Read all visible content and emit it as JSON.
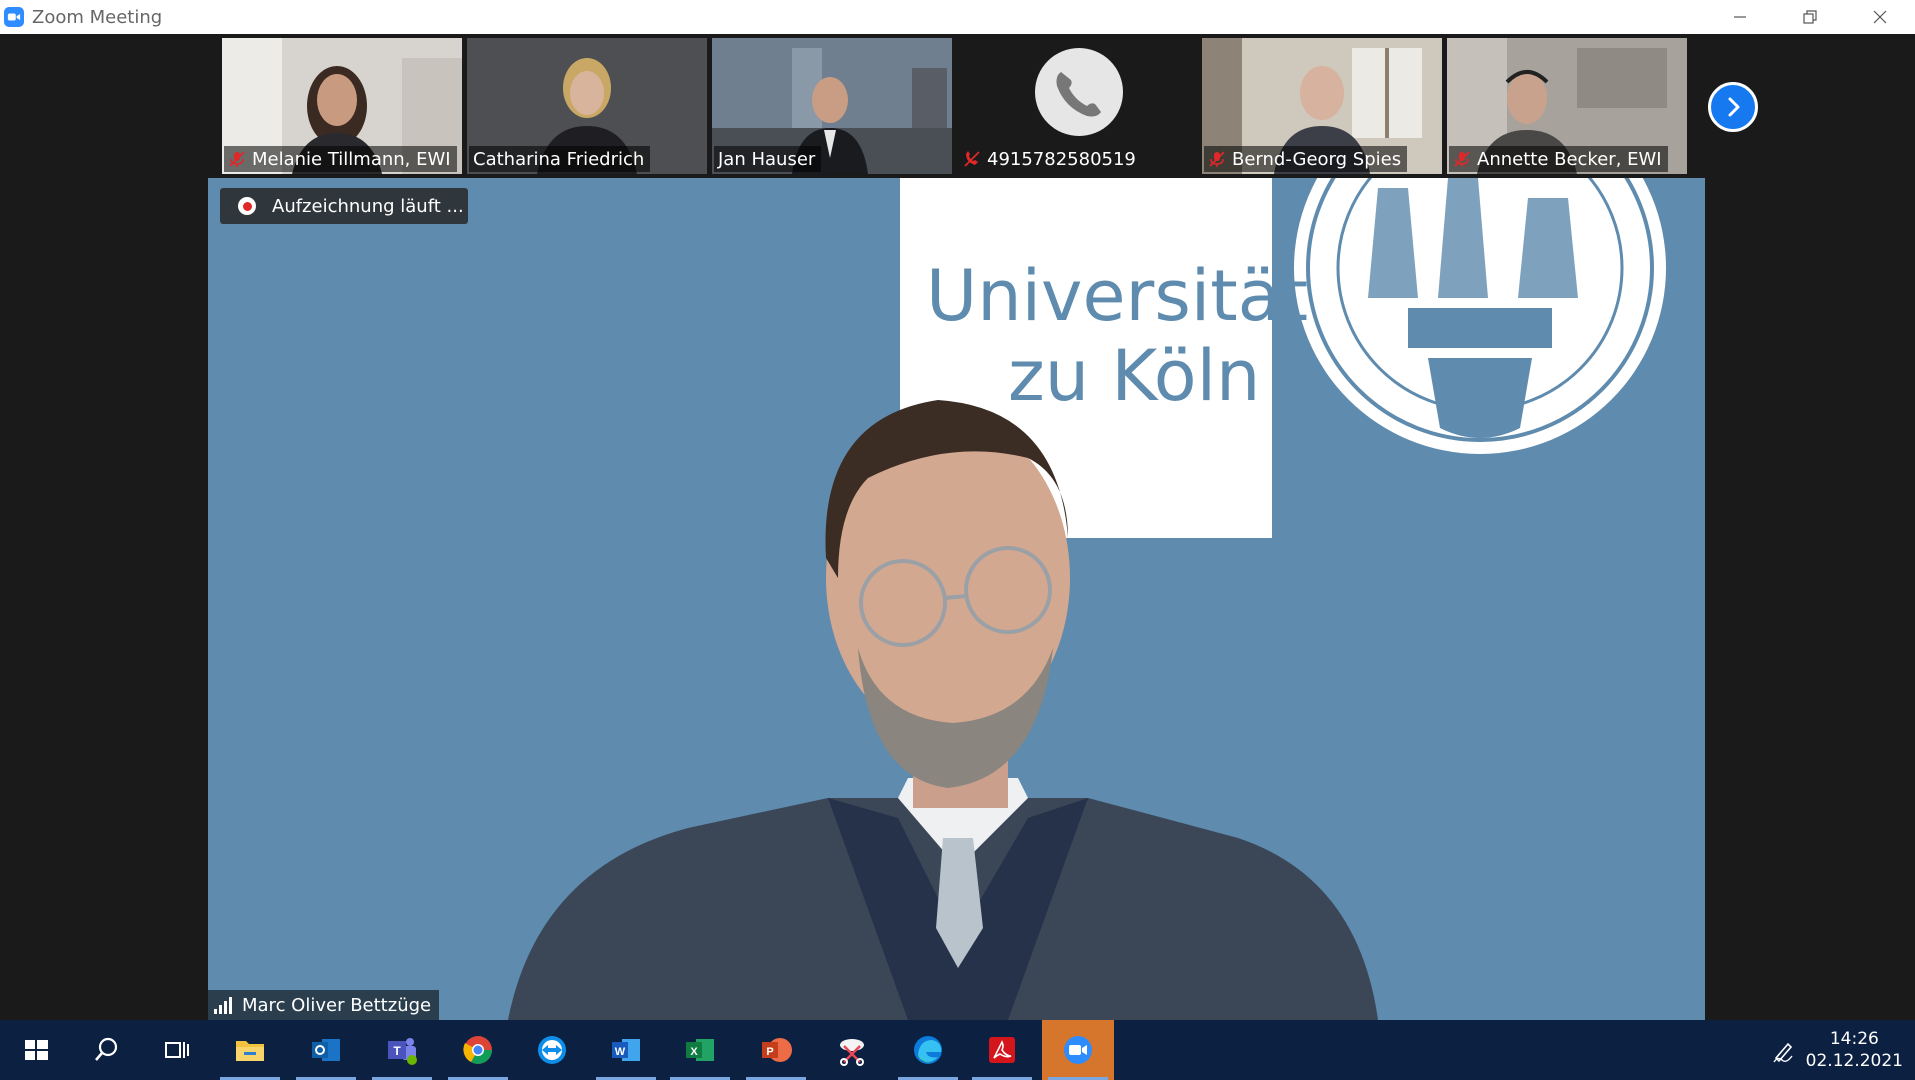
{
  "window": {
    "title": "Zoom Meeting",
    "controls": {
      "minimize": "minimize-icon",
      "restore": "restore-icon",
      "close": "close-icon"
    }
  },
  "recording": {
    "label": "Aufzeichnung läuft ..."
  },
  "participants": [
    {
      "name": "Melanie Tillmann, EWI",
      "muted": true
    },
    {
      "name": "Catharina Friedrich",
      "muted": false
    },
    {
      "name": "Jan Hauser",
      "muted": false
    },
    {
      "name": "4915782580519",
      "muted": true,
      "phone": true
    },
    {
      "name": "Bernd-Georg Spies",
      "muted": true
    },
    {
      "name": "Annette Becker, EWI",
      "muted": true
    }
  ],
  "active_speaker": {
    "name": "Marc Oliver Bettzüge"
  },
  "background": {
    "line1": "Universität",
    "line2": "zu Köln"
  },
  "taskbar": {
    "apps": [
      "start-icon",
      "search-icon",
      "task-view-icon",
      "file-explorer-icon",
      "outlook-icon",
      "teams-icon",
      "chrome-icon",
      "teamviewer-icon",
      "word-icon",
      "excel-icon",
      "powerpoint-icon",
      "snipping-icon",
      "edge-icon",
      "acrobat-icon",
      "zoom-icon"
    ],
    "time": "14:26",
    "date": "02.12.2021"
  },
  "colors": {
    "accent": "#2d8cff",
    "taskbar": "#0c2142",
    "muted": "#e02828",
    "zoom_active": "#d6762d"
  }
}
